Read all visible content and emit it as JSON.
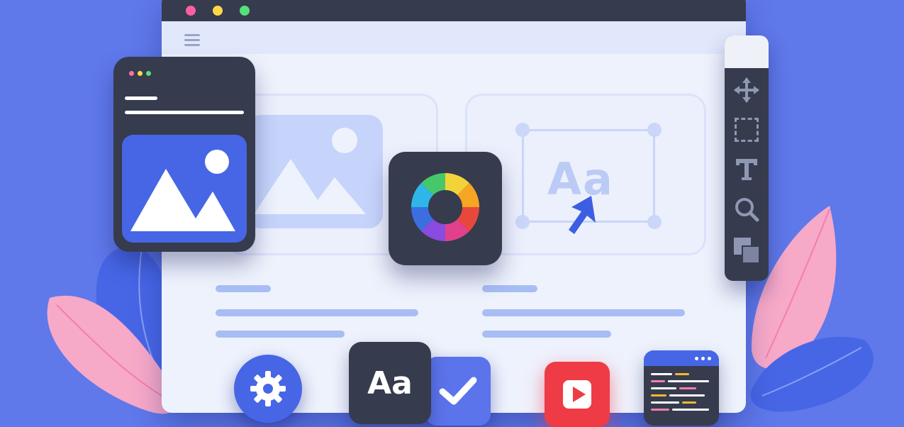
{
  "colors": {
    "background": "#5f78ea",
    "panel_dark": "#363b4e",
    "accent_blue": "#4766e6",
    "page_bg": "#eef2fd",
    "line_blue": "#a9bdf5",
    "pink_leaf": "#f7a9c8",
    "red_play": "#ef3b45"
  },
  "browser": {
    "window_dots": [
      "#ff5fa2",
      "#ffd84a",
      "#56e07b"
    ],
    "menu_icon": "hamburger-icon"
  },
  "phone_card": {
    "window_dots": [
      "#ff6fa8",
      "#ffd84a",
      "#56e07b"
    ],
    "image_icon": "mountain-image-icon"
  },
  "text_card": {
    "sample_text": "Aa",
    "cursor_icon": "pointer-arrow-icon"
  },
  "color_wheel": {
    "icon": "color-wheel-icon",
    "segments": [
      "#f2d43a",
      "#f5a623",
      "#e8483c",
      "#e0408c",
      "#8a4be0",
      "#3b6fe0",
      "#2fb6e8",
      "#46c86a"
    ]
  },
  "tool_palette": {
    "tools": [
      "move-icon",
      "marquee-select-icon",
      "text-tool-icon",
      "zoom-icon",
      "layers-icon"
    ]
  },
  "bottom_icons": {
    "settings": "gear-icon",
    "typography_label": "Aa",
    "checklist": "checkmark-icon",
    "video": "play-icon",
    "code": "code-editor-icon"
  }
}
